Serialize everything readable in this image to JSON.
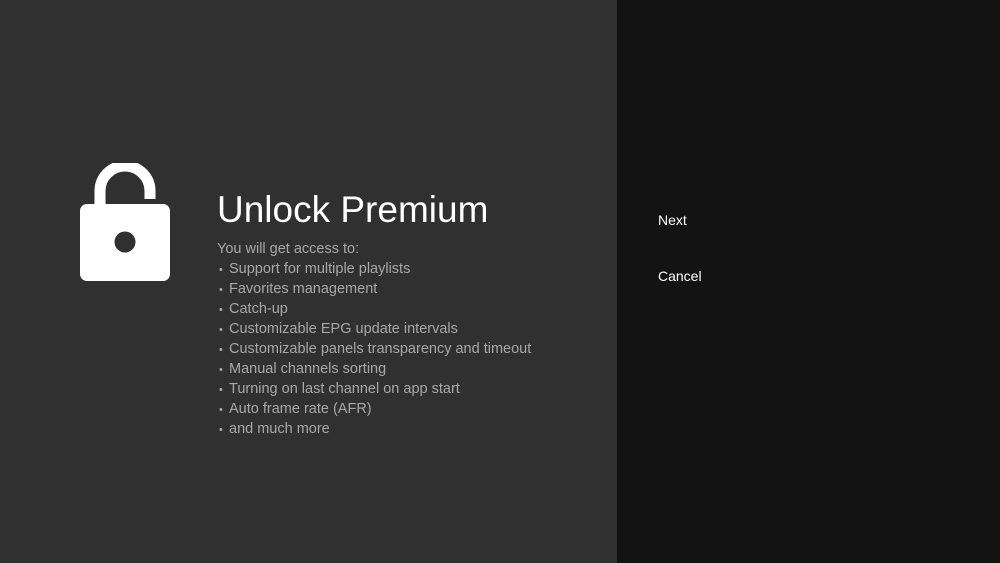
{
  "dialog": {
    "title": "Unlock Premium",
    "subtitle": "You will get access to:",
    "bullet": "•",
    "features": [
      "Support for multiple playlists",
      "Favorites management",
      "Catch-up",
      "Customizable EPG update intervals",
      "Customizable panels transparency and timeout",
      "Manual channels sorting",
      "Turning on last channel on app start",
      "Auto frame rate (AFR)",
      "and much more"
    ],
    "icon": "unlocked-padlock-icon"
  },
  "actions": {
    "next_label": "Next",
    "cancel_label": "Cancel"
  },
  "colors": {
    "left_panel_bg": "#303030",
    "right_panel_bg": "#131313",
    "title_text": "#ffffff",
    "body_text": "#a8a8a8"
  }
}
